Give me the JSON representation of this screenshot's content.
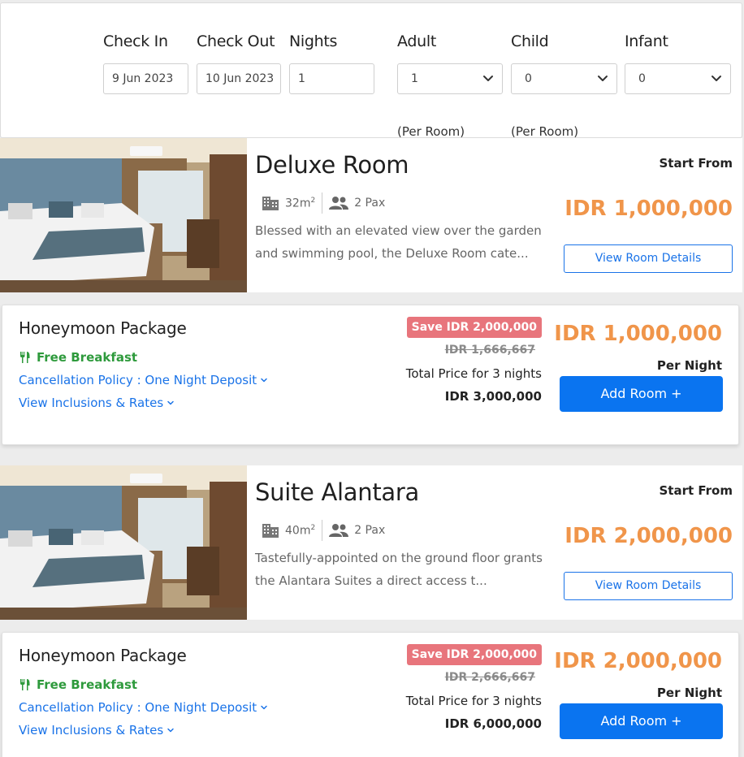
{
  "search": {
    "check_in_label": "Check In",
    "check_in_value": "9 Jun 2023",
    "check_out_label": "Check Out",
    "check_out_value": "10 Jun 2023",
    "nights_label": "Nights",
    "nights_value": "1",
    "adult_label": "Adult",
    "adult_value": "1",
    "adult_note": "(Per Room)",
    "child_label": "Child",
    "child_value": "0",
    "child_note": "(Per Room)",
    "infant_label": "Infant",
    "infant_value": "0"
  },
  "rooms": [
    {
      "name": "Deluxe Room",
      "size": "32m",
      "size_sup": "2",
      "pax": "2 Pax",
      "description": "Blessed with an elevated view over the garden and swimming pool, the Deluxe Room cate...",
      "start_from_label": "Start From",
      "start_price": "IDR 1,000,000",
      "view_details_label": "View Room Details",
      "package": {
        "name": "Honeymoon Package",
        "breakfast": "Free Breakfast",
        "cancellation": "Cancellation Policy : One Night Deposit",
        "inclusions": "View Inclusions & Rates",
        "save_badge": "Save IDR 2,000,000",
        "original_price": "IDR 1,666,667",
        "total_label": "Total Price for 3 nights",
        "total_value": "IDR 3,000,000",
        "price": "IDR 1,000,000",
        "per_night": "Per Night",
        "add_label": "Add Room  +"
      }
    },
    {
      "name": "Suite Alantara",
      "size": "40m",
      "size_sup": "2",
      "pax": "2 Pax",
      "description": "Tastefully-appointed on the ground floor grants the Alantara Suites a direct access t...",
      "start_from_label": "Start From",
      "start_price": "IDR 2,000,000",
      "view_details_label": "View Room Details",
      "package": {
        "name": "Honeymoon Package",
        "breakfast": "Free Breakfast",
        "cancellation": "Cancellation Policy : One Night Deposit",
        "inclusions": "View Inclusions & Rates",
        "save_badge": "Save IDR 2,000,000",
        "original_price": "IDR 2,666,667",
        "total_label": "Total Price for 3 nights",
        "total_value": "IDR 6,000,000",
        "price": "IDR 2,000,000",
        "per_night": "Per Night",
        "add_label": "Add Room  +"
      }
    }
  ],
  "colors": {
    "accent_price": "#f0954a",
    "primary": "#0a74f0",
    "save_badge": "#e8757c",
    "breakfast": "#2e9a3c"
  },
  "icons": [
    "chevron-down-icon",
    "building-icon",
    "people-icon",
    "fork-knife-icon"
  ]
}
